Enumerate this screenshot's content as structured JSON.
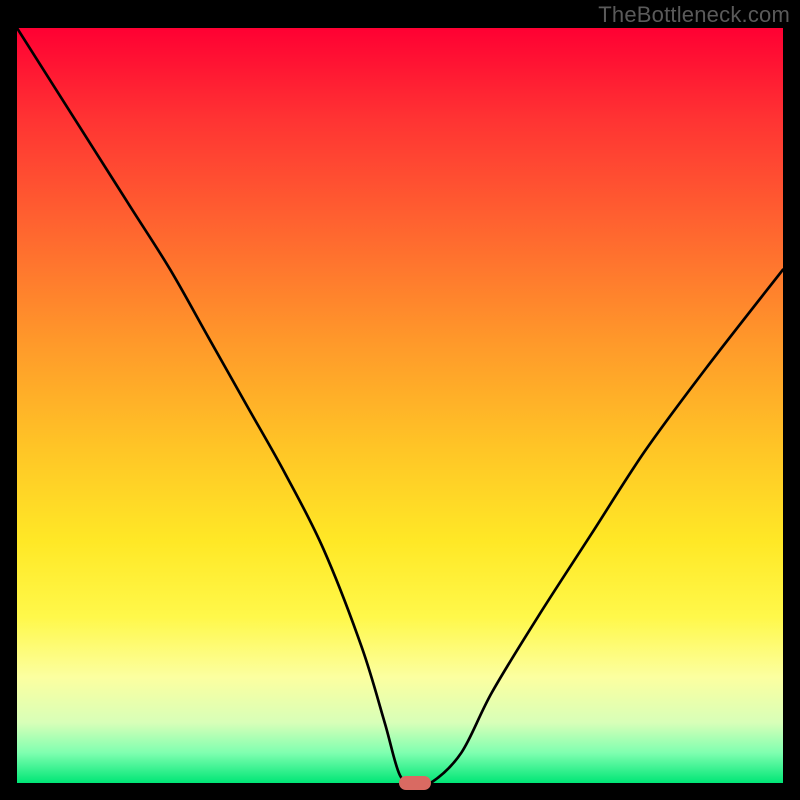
{
  "watermark": "TheBottleneck.com",
  "chart_data": {
    "type": "line",
    "title": "",
    "xlabel": "",
    "ylabel": "",
    "xlim": [
      0,
      100
    ],
    "ylim": [
      0,
      100
    ],
    "grid": false,
    "legend": false,
    "series": [
      {
        "name": "bottleneck-curve",
        "x": [
          0,
          5,
          10,
          15,
          20,
          25,
          30,
          35,
          40,
          45,
          48,
          50,
          52,
          54,
          58,
          62,
          68,
          75,
          82,
          90,
          100
        ],
        "y": [
          100,
          92,
          84,
          76,
          68,
          59,
          50,
          41,
          31,
          18,
          8,
          1,
          0,
          0,
          4,
          12,
          22,
          33,
          44,
          55,
          68
        ]
      }
    ],
    "background_gradient": {
      "top": "#ff0033",
      "mid": "#ffe826",
      "bottom": "#00e676"
    },
    "marker": {
      "x": 52,
      "y": 0,
      "color": "#d96a62",
      "shape": "pill"
    }
  }
}
